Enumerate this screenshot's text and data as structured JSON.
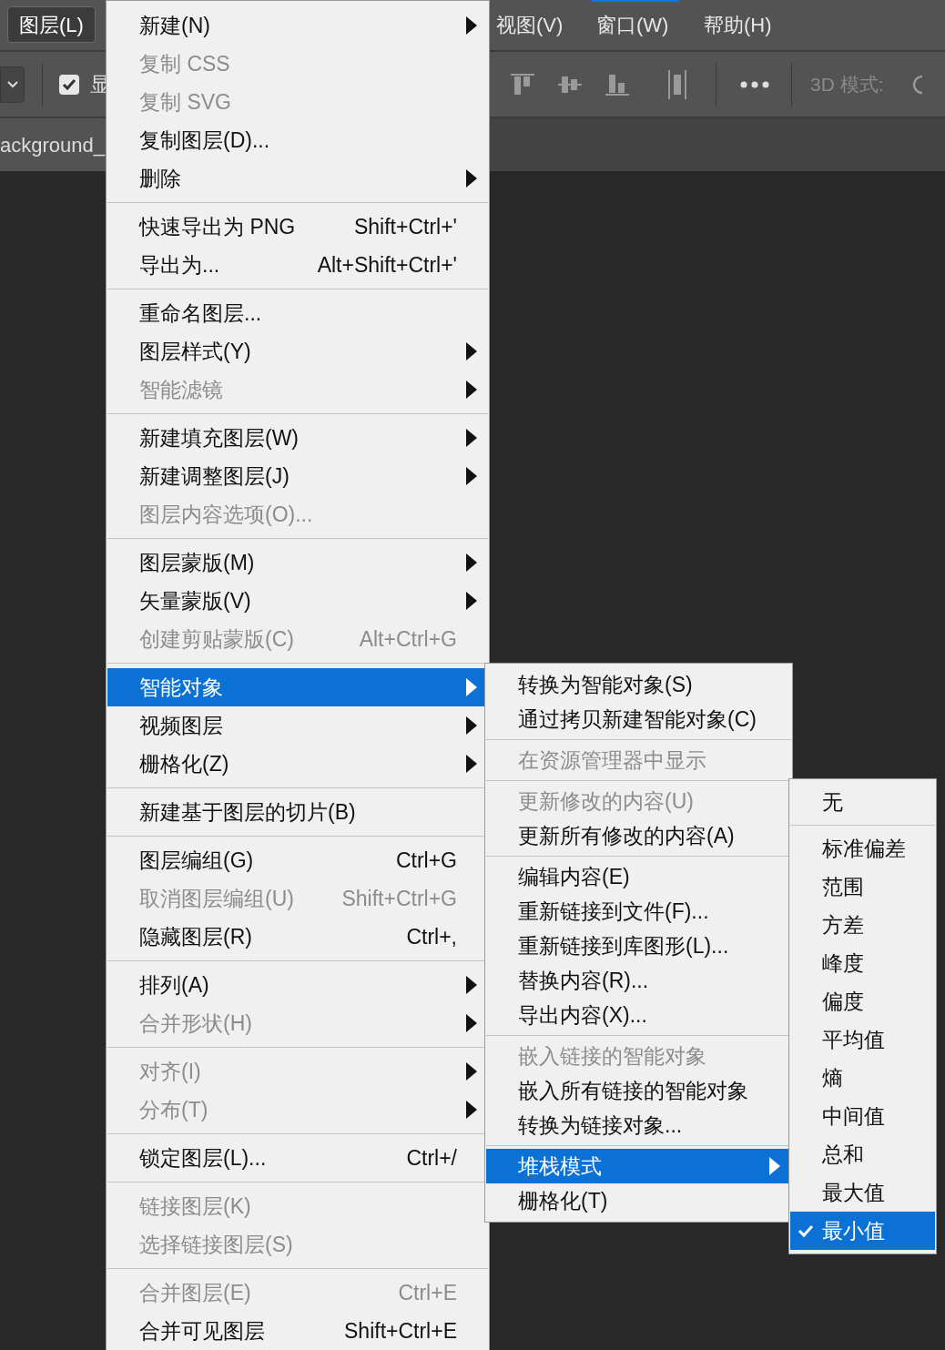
{
  "menubar": {
    "items": [
      {
        "label": "图层(L)",
        "selected": true
      },
      {
        "label": "视图(V)",
        "selected": false
      },
      {
        "label": "窗口(W)",
        "selected": false
      },
      {
        "label": "帮助(H)",
        "selected": false
      }
    ]
  },
  "toolbar": {
    "checkbox": {
      "label": "显",
      "checked": true
    },
    "mode_label": "3D 模式:"
  },
  "document_tab": {
    "label": "ackground_"
  },
  "layer_menu": {
    "items": [
      {
        "kind": "item",
        "label": "新建(N)",
        "disabled": false,
        "submenu": true,
        "selected": false
      },
      {
        "kind": "item",
        "label": "复制 CSS",
        "disabled": true,
        "submenu": false,
        "selected": false
      },
      {
        "kind": "item",
        "label": "复制 SVG",
        "disabled": true,
        "submenu": false,
        "selected": false
      },
      {
        "kind": "item",
        "label": "复制图层(D)...",
        "disabled": false,
        "submenu": false,
        "selected": false
      },
      {
        "kind": "item",
        "label": "删除",
        "disabled": false,
        "submenu": true,
        "selected": false
      },
      {
        "kind": "separator"
      },
      {
        "kind": "item",
        "label": "快速导出为 PNG",
        "shortcut": "Shift+Ctrl+'",
        "disabled": false,
        "submenu": false,
        "selected": false
      },
      {
        "kind": "item",
        "label": "导出为...",
        "shortcut": "Alt+Shift+Ctrl+'",
        "disabled": false,
        "submenu": false,
        "selected": false
      },
      {
        "kind": "separator"
      },
      {
        "kind": "item",
        "label": "重命名图层...",
        "disabled": false,
        "submenu": false,
        "selected": false
      },
      {
        "kind": "item",
        "label": "图层样式(Y)",
        "disabled": false,
        "submenu": true,
        "selected": false
      },
      {
        "kind": "item",
        "label": "智能滤镜",
        "disabled": true,
        "submenu": true,
        "selected": false
      },
      {
        "kind": "separator"
      },
      {
        "kind": "item",
        "label": "新建填充图层(W)",
        "disabled": false,
        "submenu": true,
        "selected": false
      },
      {
        "kind": "item",
        "label": "新建调整图层(J)",
        "disabled": false,
        "submenu": true,
        "selected": false
      },
      {
        "kind": "item",
        "label": "图层内容选项(O)...",
        "disabled": true,
        "submenu": false,
        "selected": false
      },
      {
        "kind": "separator"
      },
      {
        "kind": "item",
        "label": "图层蒙版(M)",
        "disabled": false,
        "submenu": true,
        "selected": false
      },
      {
        "kind": "item",
        "label": "矢量蒙版(V)",
        "disabled": false,
        "submenu": true,
        "selected": false
      },
      {
        "kind": "item",
        "label": "创建剪贴蒙版(C)",
        "shortcut": "Alt+Ctrl+G",
        "disabled": true,
        "submenu": false,
        "selected": false
      },
      {
        "kind": "separator"
      },
      {
        "kind": "item",
        "label": "智能对象",
        "disabled": false,
        "submenu": true,
        "selected": true
      },
      {
        "kind": "item",
        "label": "视频图层",
        "disabled": false,
        "submenu": true,
        "selected": false
      },
      {
        "kind": "item",
        "label": "栅格化(Z)",
        "disabled": false,
        "submenu": true,
        "selected": false
      },
      {
        "kind": "separator"
      },
      {
        "kind": "item",
        "label": "新建基于图层的切片(B)",
        "disabled": false,
        "submenu": false,
        "selected": false
      },
      {
        "kind": "separator"
      },
      {
        "kind": "item",
        "label": "图层编组(G)",
        "shortcut": "Ctrl+G",
        "disabled": false,
        "submenu": false,
        "selected": false
      },
      {
        "kind": "item",
        "label": "取消图层编组(U)",
        "shortcut": "Shift+Ctrl+G",
        "disabled": true,
        "submenu": false,
        "selected": false
      },
      {
        "kind": "item",
        "label": "隐藏图层(R)",
        "shortcut": "Ctrl+,",
        "disabled": false,
        "submenu": false,
        "selected": false
      },
      {
        "kind": "separator"
      },
      {
        "kind": "item",
        "label": "排列(A)",
        "disabled": false,
        "submenu": true,
        "selected": false
      },
      {
        "kind": "item",
        "label": "合并形状(H)",
        "disabled": true,
        "submenu": true,
        "selected": false
      },
      {
        "kind": "separator"
      },
      {
        "kind": "item",
        "label": "对齐(I)",
        "disabled": true,
        "submenu": true,
        "selected": false
      },
      {
        "kind": "item",
        "label": "分布(T)",
        "disabled": true,
        "submenu": true,
        "selected": false
      },
      {
        "kind": "separator"
      },
      {
        "kind": "item",
        "label": "锁定图层(L)...",
        "shortcut": "Ctrl+/",
        "disabled": false,
        "submenu": false,
        "selected": false
      },
      {
        "kind": "separator"
      },
      {
        "kind": "item",
        "label": "链接图层(K)",
        "disabled": true,
        "submenu": false,
        "selected": false
      },
      {
        "kind": "item",
        "label": "选择链接图层(S)",
        "disabled": true,
        "submenu": false,
        "selected": false
      },
      {
        "kind": "separator"
      },
      {
        "kind": "item",
        "label": "合并图层(E)",
        "shortcut": "Ctrl+E",
        "disabled": true,
        "submenu": false,
        "selected": false
      },
      {
        "kind": "item",
        "label": "合并可见图层",
        "shortcut": "Shift+Ctrl+E",
        "disabled": false,
        "submenu": false,
        "selected": false
      }
    ]
  },
  "smart_object_menu": {
    "items": [
      {
        "kind": "item",
        "label": "转换为智能对象(S)",
        "disabled": false,
        "submenu": false,
        "selected": false
      },
      {
        "kind": "item",
        "label": "通过拷贝新建智能对象(C)",
        "disabled": false,
        "submenu": false,
        "selected": false
      },
      {
        "kind": "separator"
      },
      {
        "kind": "item",
        "label": "在资源管理器中显示",
        "disabled": true,
        "submenu": false,
        "selected": false
      },
      {
        "kind": "separator"
      },
      {
        "kind": "item",
        "label": "更新修改的内容(U)",
        "disabled": true,
        "submenu": false,
        "selected": false
      },
      {
        "kind": "item",
        "label": "更新所有修改的内容(A)",
        "disabled": false,
        "submenu": false,
        "selected": false
      },
      {
        "kind": "separator"
      },
      {
        "kind": "item",
        "label": "编辑内容(E)",
        "disabled": false,
        "submenu": false,
        "selected": false
      },
      {
        "kind": "item",
        "label": "重新链接到文件(F)...",
        "disabled": false,
        "submenu": false,
        "selected": false
      },
      {
        "kind": "item",
        "label": "重新链接到库图形(L)...",
        "disabled": false,
        "submenu": false,
        "selected": false
      },
      {
        "kind": "item",
        "label": "替换内容(R)...",
        "disabled": false,
        "submenu": false,
        "selected": false
      },
      {
        "kind": "item",
        "label": "导出内容(X)...",
        "disabled": false,
        "submenu": false,
        "selected": false
      },
      {
        "kind": "separator"
      },
      {
        "kind": "item",
        "label": "嵌入链接的智能对象",
        "disabled": true,
        "submenu": false,
        "selected": false
      },
      {
        "kind": "item",
        "label": "嵌入所有链接的智能对象",
        "disabled": false,
        "submenu": false,
        "selected": false
      },
      {
        "kind": "item",
        "label": "转换为链接对象...",
        "disabled": false,
        "submenu": false,
        "selected": false
      },
      {
        "kind": "separator"
      },
      {
        "kind": "item",
        "label": "堆栈模式",
        "disabled": false,
        "submenu": true,
        "selected": true
      },
      {
        "kind": "item",
        "label": "栅格化(T)",
        "disabled": false,
        "submenu": false,
        "selected": false
      }
    ]
  },
  "stack_mode_menu": {
    "items": [
      {
        "kind": "item",
        "label": "无",
        "checked": false,
        "selected": false
      },
      {
        "kind": "separator"
      },
      {
        "kind": "item",
        "label": "标准偏差",
        "checked": false,
        "selected": false
      },
      {
        "kind": "item",
        "label": "范围",
        "checked": false,
        "selected": false
      },
      {
        "kind": "item",
        "label": "方差",
        "checked": false,
        "selected": false
      },
      {
        "kind": "item",
        "label": "峰度",
        "checked": false,
        "selected": false
      },
      {
        "kind": "item",
        "label": "偏度",
        "checked": false,
        "selected": false
      },
      {
        "kind": "item",
        "label": "平均值",
        "checked": false,
        "selected": false
      },
      {
        "kind": "item",
        "label": "熵",
        "checked": false,
        "selected": false
      },
      {
        "kind": "item",
        "label": "中间值",
        "checked": false,
        "selected": false
      },
      {
        "kind": "item",
        "label": "总和",
        "checked": false,
        "selected": false
      },
      {
        "kind": "item",
        "label": "最大值",
        "checked": false,
        "selected": false
      },
      {
        "kind": "item",
        "label": "最小值",
        "checked": true,
        "selected": true
      }
    ]
  }
}
